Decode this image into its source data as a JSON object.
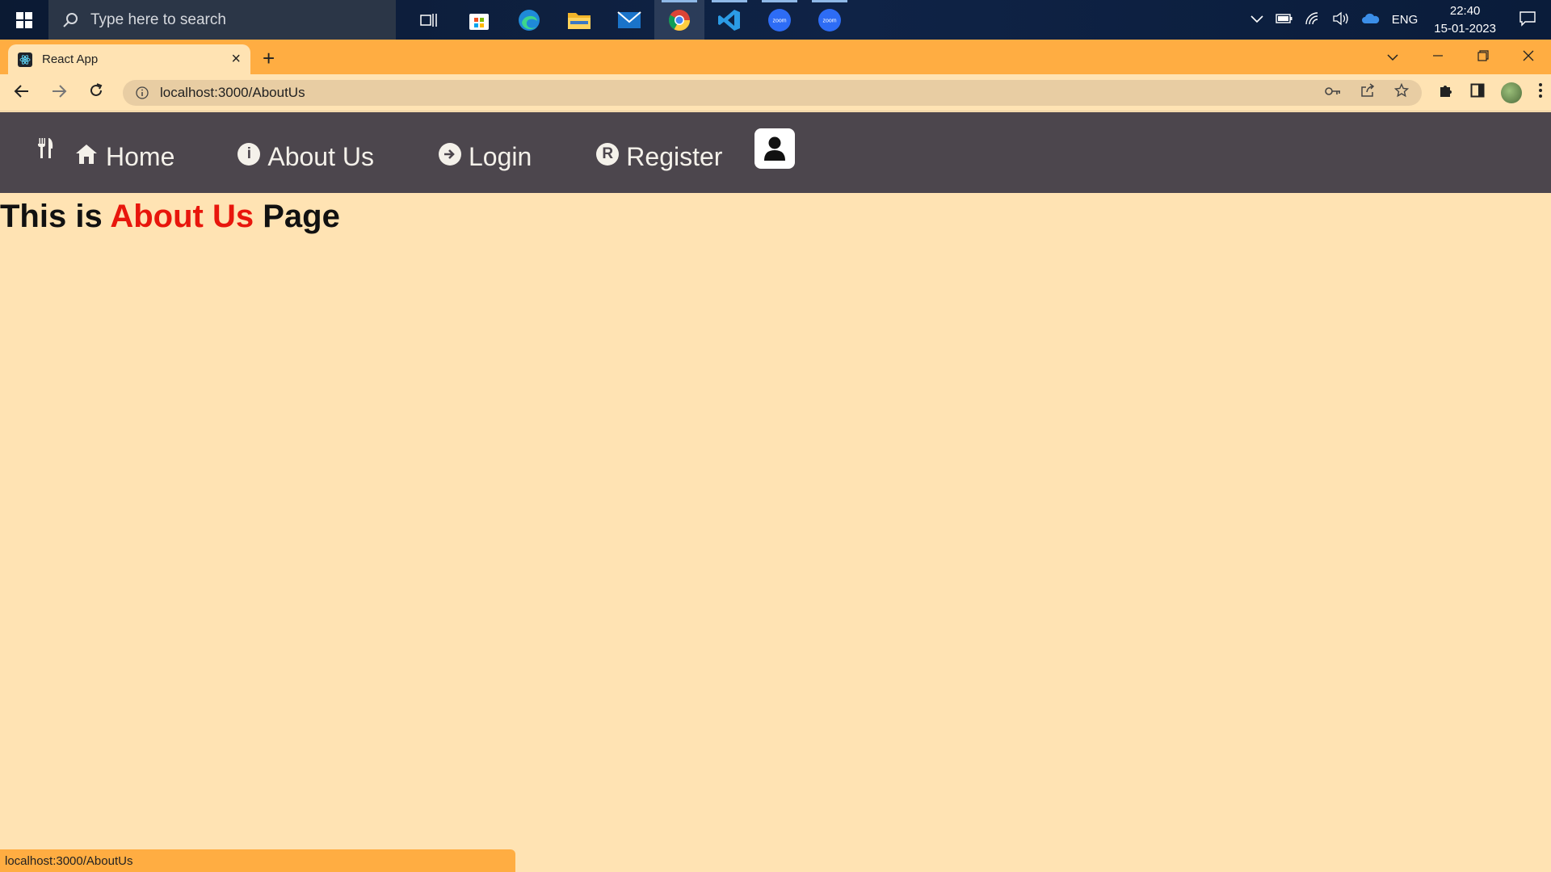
{
  "taskbar": {
    "search_placeholder": "Type here to search",
    "apps": [
      "task-view",
      "microsoft-store",
      "edge",
      "file-explorer",
      "mail",
      "chrome",
      "vscode",
      "zoom",
      "zoom"
    ],
    "tray": {
      "language": "ENG",
      "time": "22:40",
      "date": "15-01-2023"
    }
  },
  "browser": {
    "tab_title": "React App",
    "url": "localhost:3000/AboutUs",
    "status_url": "localhost:3000/AboutUs",
    "theme_color": "#ffad42"
  },
  "navbar": {
    "bg_color": "#4c464d",
    "items": [
      {
        "label": "Home",
        "icon": "home-icon"
      },
      {
        "label": "About Us",
        "icon": "info-icon"
      },
      {
        "label": "Login",
        "icon": "login-icon"
      },
      {
        "label": "Register",
        "icon": "registered-icon"
      }
    ]
  },
  "page": {
    "heading_prefix": "This is ",
    "heading_accent": "About Us",
    "heading_suffix": " Page",
    "accent_color": "#e8160c",
    "bg_color": "#ffe3b3"
  }
}
